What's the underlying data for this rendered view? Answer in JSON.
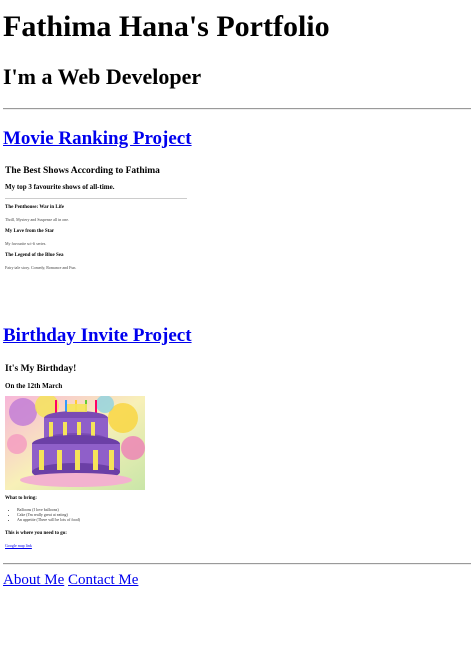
{
  "header": {
    "title": "Fathima Hana's Portfolio",
    "subtitle": "I'm a Web Developer"
  },
  "projects": [
    {
      "link": "Movie Ranking Project",
      "preview": {
        "title": "The Best Shows According to Fathima",
        "subtitle": "My top 3 favourite shows of all-time.",
        "items": [
          {
            "name": "The Penthouse: War in Life",
            "desc": "Thrill, Mystery and Suspense all in one."
          },
          {
            "name": "My Love from the Star",
            "desc": "My favourite sci-fi series."
          },
          {
            "name": "The Legend of the Blue Sea",
            "desc": "Fairy tale story. Comedy, Romance and Fun."
          }
        ]
      }
    },
    {
      "link": "Birthday Invite Project",
      "preview": {
        "title": "It's My Birthday!",
        "date": "On the 12th March",
        "bring_heading": "What to bring:",
        "bring_items": [
          "Balloons (I love balloons)",
          "Cake (I'm really great at eating)",
          "An appetite (There will be lots of food)"
        ],
        "where_heading": "This is where you need to go:",
        "map_link": "Google map link"
      }
    }
  ],
  "footer": {
    "about": "About Me",
    "contact": "Contact Me"
  }
}
